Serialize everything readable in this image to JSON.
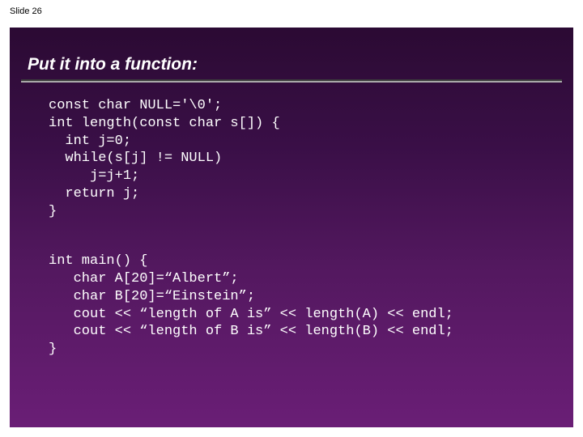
{
  "slide_label": "Slide 26",
  "title": "Put it into a function:",
  "code_block_1": "const char NULL='\\0';\nint length(const char s[]) {\n  int j=0;\n  while(s[j] != NULL)\n     j=j+1;\n  return j;\n}",
  "code_block_2": "int main() {\n   char A[20]=“Albert”;\n   char B[20]=“Einstein”;\n   cout << “length of A is” << length(A) << endl;\n   cout << “length of B is” << length(B) << endl;\n}"
}
